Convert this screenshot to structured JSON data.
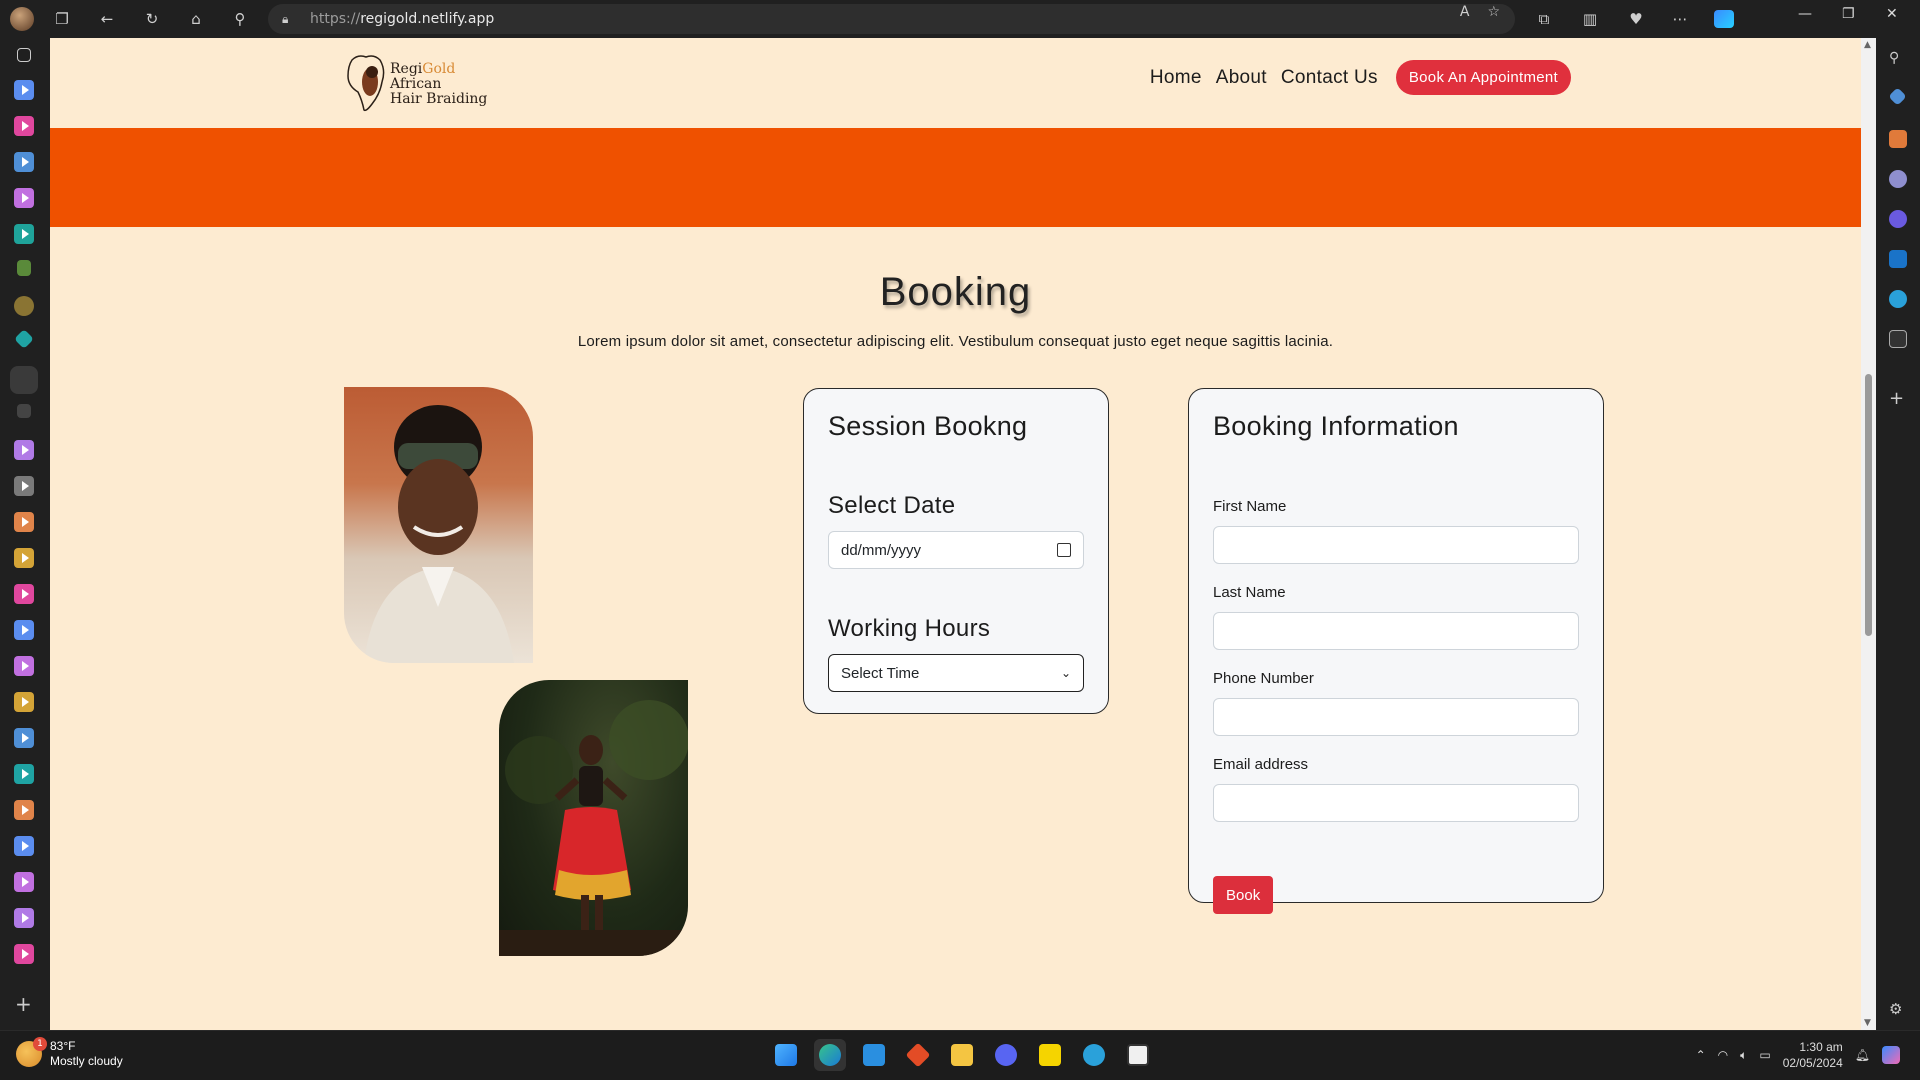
{
  "browser": {
    "url_prefix": "https://",
    "url_host": "regigold.netlify.app"
  },
  "site": {
    "logo_line1_a": "Regi",
    "logo_line1_b": "Gold",
    "logo_line2": "African",
    "logo_line3": "Hair Braiding",
    "nav": {
      "home": "Home",
      "about": "About",
      "contact": "Contact Us",
      "cta": "Book An Appointment"
    },
    "title": "Booking",
    "subtitle": "Lorem ipsum dolor sit amet, consectetur adipiscing elit. Vestibulum consequat justo eget neque sagittis lacinia."
  },
  "session": {
    "heading": "Session Bookng",
    "date_label": "Select Date",
    "date_placeholder": "dd/mm/yyyy",
    "hours_label": "Working Hours",
    "time_select": "Select Time"
  },
  "info": {
    "heading": "Booking Information",
    "first_name": "First Name",
    "last_name": "Last Name",
    "phone": "Phone Number",
    "email": "Email address",
    "book": "Book"
  },
  "taskbar": {
    "temp": "83°F",
    "weather": "Mostly cloudy",
    "badge": "1",
    "time": "1:30 am",
    "date": "02/05/2024"
  },
  "colors": {
    "page_bg": "#fdebd1",
    "orange_band": "#ef5100",
    "brand_red": "#e0303d"
  }
}
